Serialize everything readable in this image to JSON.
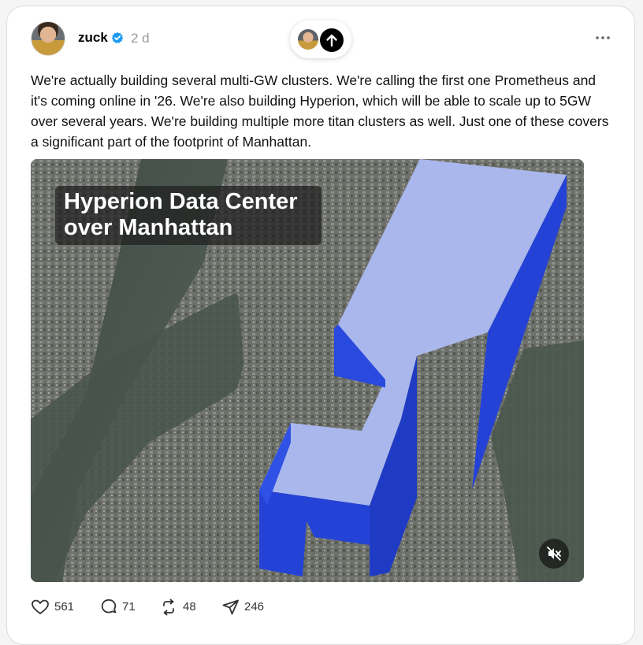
{
  "post": {
    "username": "zuck",
    "time": "2 d",
    "text": "We're actually building several multi-GW clusters. We're calling the first one Prometheus and it's coming online in '26. We're also building Hyperion, which will be able to scale up to 5GW over several years. We're building multiple more titan clusters as well. Just one of these covers a significant part of the footprint of Manhattan.",
    "media": {
      "overlay_line1": "Hyperion Data Center",
      "overlay_line2": "over Manhattan"
    },
    "actions": {
      "likes": "561",
      "replies": "71",
      "reposts": "48",
      "shares": "246"
    }
  },
  "colors": {
    "verified": "#1d9bf0",
    "block_face": "#aab7ec",
    "block_side": "#2443d6"
  },
  "icons": [
    "verified-icon",
    "arrow-up-icon",
    "more-icon",
    "mute-icon",
    "heart-icon",
    "comment-icon",
    "repost-icon",
    "send-icon"
  ]
}
